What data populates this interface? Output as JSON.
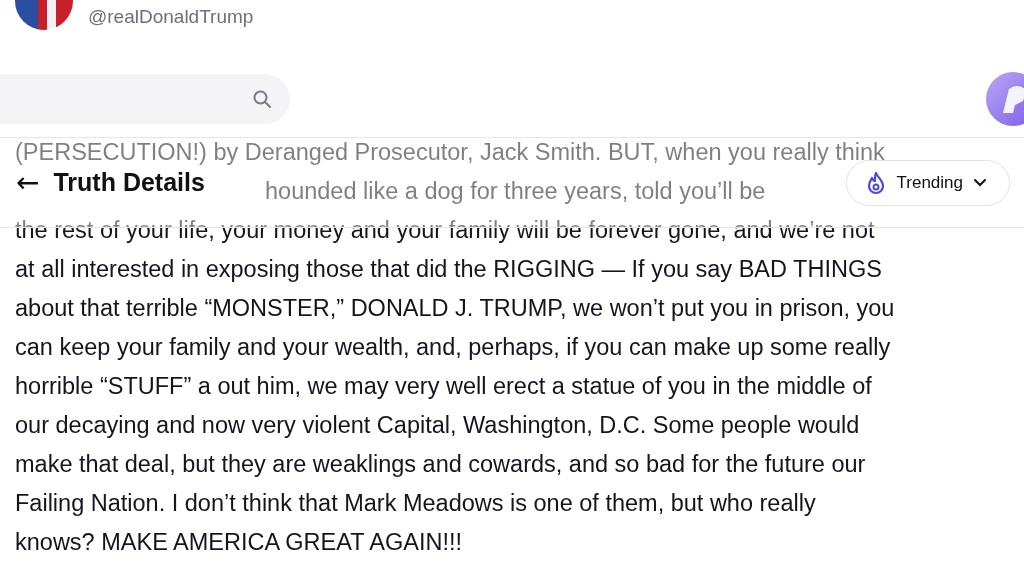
{
  "profile": {
    "handle": "@realDonaldTrump"
  },
  "header": {
    "back": "←",
    "title": "Truth Details",
    "feed_selector": {
      "label": "Trending",
      "expanded": false
    }
  },
  "post": {
    "lines": [
      {
        "kind": "full",
        "text": "(PERSECUTION!) by Deranged Prosecutor, Jack Smith. BUT, when you really think"
      },
      {
        "kind": "covered_start",
        "text": "hounded like a dog for three years, told you’ll be"
      },
      {
        "kind": "full",
        "text": "the rest of your life, your money and your family will be forever gone, and we’re not"
      },
      {
        "kind": "full",
        "text": "at all interested in exposing those that did the RIGGING — If you say BAD THINGS"
      },
      {
        "kind": "full",
        "text": "about that terrible “MONSTER,” DONALD J. TRUMP, we won’t put you in prison, you"
      },
      {
        "kind": "full",
        "text": "can keep your family and your wealth, and, perhaps, if you can make up some really"
      },
      {
        "kind": "full",
        "text": "horrible “STUFF” a out him, we may very well erect a statue of you in the middle of"
      },
      {
        "kind": "full",
        "text": "our decaying and now very violent Capital, Washington, D.C. Some people would"
      },
      {
        "kind": "full",
        "text": "make that deal, but they are weaklings and cowards, and so bad for the future our"
      },
      {
        "kind": "full",
        "text": "Failing Nation. I don’t think that Mark Meadows is one of them, but who really"
      },
      {
        "kind": "full",
        "text": "knows? MAKE AMERICA GREAT AGAIN!!!"
      }
    ]
  }
}
